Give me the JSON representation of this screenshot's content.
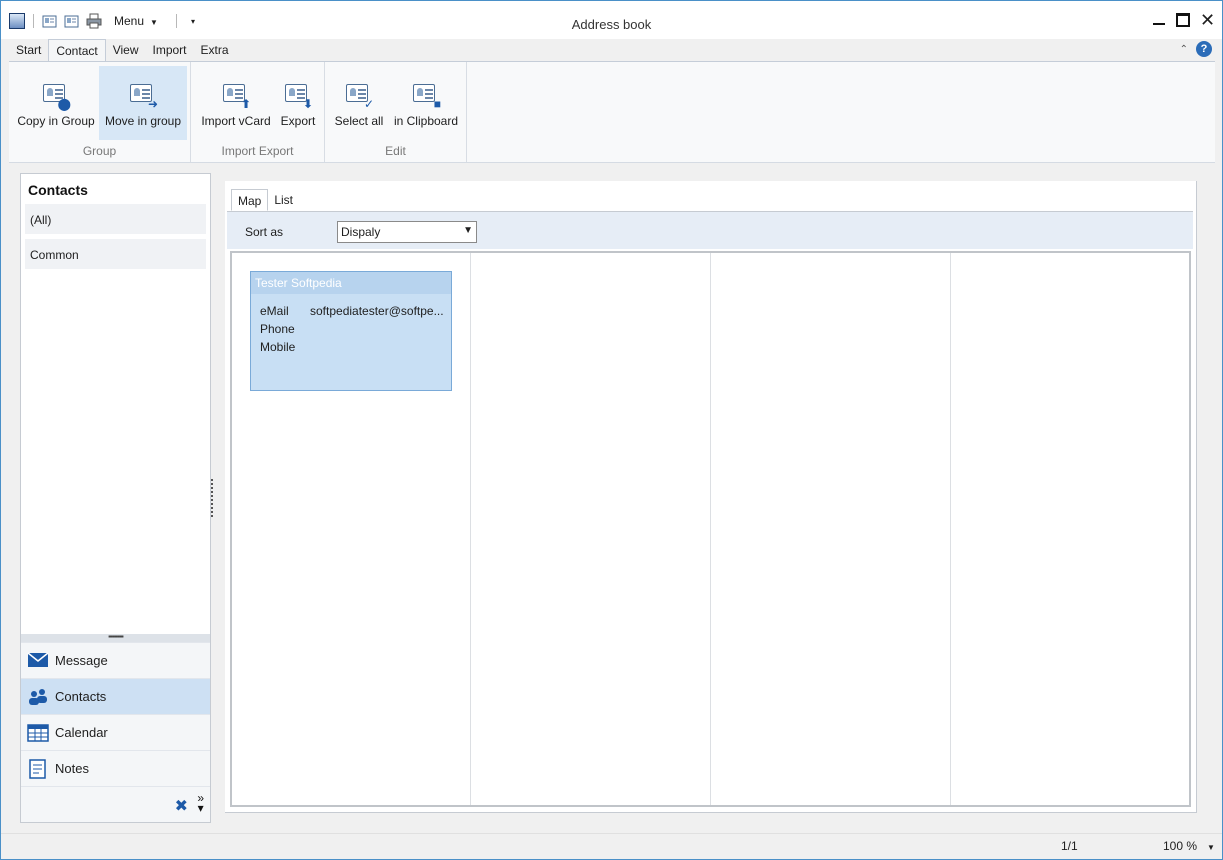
{
  "window": {
    "title": "Address book"
  },
  "quick_access": {
    "menu_label": "Menu"
  },
  "ribbon_tabs": [
    "Start",
    "Contact",
    "View",
    "Import",
    "Extra"
  ],
  "ribbon": {
    "groups": [
      {
        "label": "Group",
        "buttons": [
          "Copy in Group",
          "Move in group"
        ]
      },
      {
        "label": "Import Export",
        "buttons": [
          "Import vCard",
          "Export"
        ]
      },
      {
        "label": "Edit",
        "buttons": [
          "Select all",
          "in Clipboard"
        ]
      }
    ]
  },
  "sidebar": {
    "title": "Contacts",
    "folders": [
      "(All)",
      "Common"
    ],
    "nav": [
      {
        "label": "Message",
        "icon": "envelope-icon"
      },
      {
        "label": "Contacts",
        "icon": "people-icon"
      },
      {
        "label": "Calendar",
        "icon": "calendar-icon"
      },
      {
        "label": "Notes",
        "icon": "notes-icon"
      }
    ]
  },
  "content": {
    "tabs": [
      "Map",
      "List"
    ],
    "sort_label": "Sort as",
    "sort_value": "Dispaly",
    "card": {
      "name": "Tester Softpedia",
      "fields": [
        {
          "label": "eMail",
          "value": "softpediatester@softpe..."
        },
        {
          "label": "Phone",
          "value": ""
        },
        {
          "label": "Mobile",
          "value": ""
        }
      ]
    }
  },
  "status": {
    "page": "1/1",
    "zoom": "100 %"
  },
  "colors": {
    "accent": "#1d5aa8",
    "selection": "#cde0f3",
    "card": "#c8dff4"
  }
}
